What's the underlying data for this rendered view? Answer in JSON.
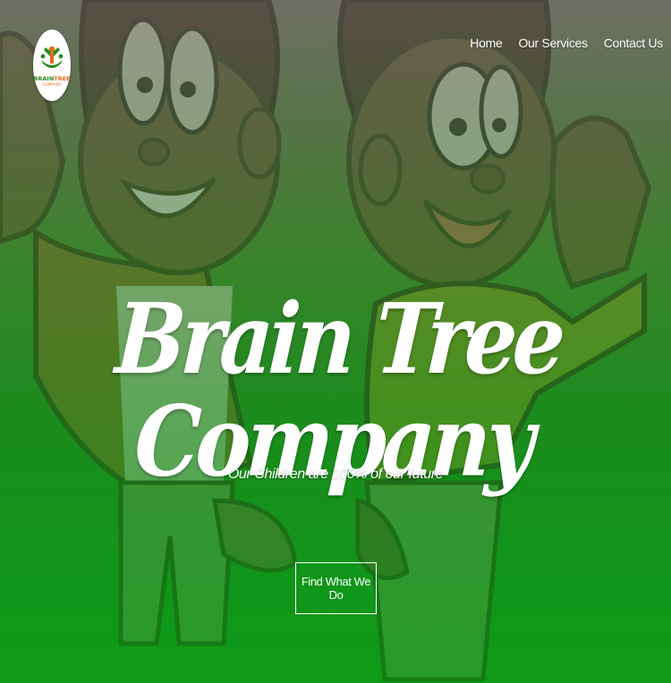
{
  "brand": {
    "logo_icon": "tree-people-icon",
    "logo_name_part1": "BRAIN",
    "logo_name_part2": "TREE",
    "logo_sub": "COMPANY",
    "colors": {
      "green": "#2a8a1f",
      "orange": "#e86a14"
    }
  },
  "nav": {
    "items": [
      {
        "label": "Home"
      },
      {
        "label": "Our Services"
      },
      {
        "label": "Contact Us"
      }
    ]
  },
  "hero": {
    "headline": "Brain Tree Company",
    "tagline": "Our Children are 100% of our future",
    "cta_label": "Find What We Do",
    "background_image": "cartoon-kids-waving-illustration"
  }
}
